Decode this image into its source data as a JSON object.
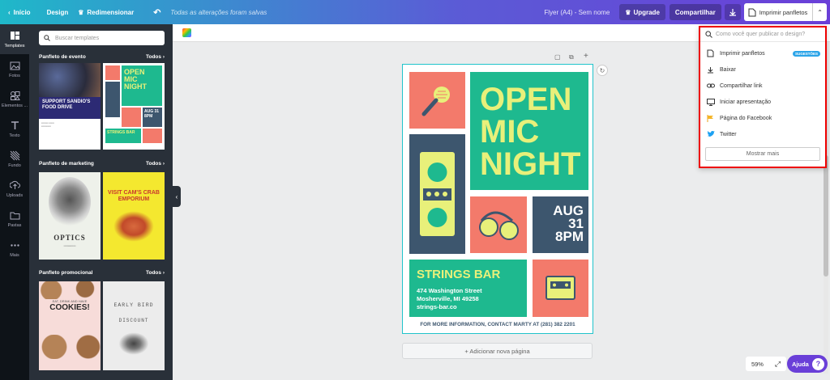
{
  "topbar": {
    "home": "Início",
    "design": "Design",
    "resize": "Redimensionar",
    "saved": "Todas as alterações foram salvas",
    "doc_name": "Flyer (A4) - Sem nome",
    "upgrade": "Upgrade",
    "share": "Compartilhar",
    "print": "Imprimir panfletos"
  },
  "rail": [
    {
      "label": "Templates",
      "icon": "templates-icon"
    },
    {
      "label": "Fotos",
      "icon": "photo-icon"
    },
    {
      "label": "Elementos ...",
      "icon": "shapes-icon"
    },
    {
      "label": "Texto",
      "icon": "text-icon"
    },
    {
      "label": "Fundo",
      "icon": "background-icon"
    },
    {
      "label": "Uploads",
      "icon": "upload-icon"
    },
    {
      "label": "Pastas",
      "icon": "folder-icon"
    },
    {
      "label": "Mais",
      "icon": "more-icon"
    }
  ],
  "panel": {
    "search_placeholder": "Buscar templates",
    "sections": [
      {
        "title": "Panfleto de evento",
        "all": "Todos"
      },
      {
        "title": "Panfleto de marketing",
        "all": "Todos"
      },
      {
        "title": "Panfleto promocional",
        "all": "Todos"
      }
    ],
    "thumbs": {
      "t1": {
        "title": "SUPPORT SANDIO'S FOOD DRIVE"
      },
      "t2": {
        "title": "OPEN MIC NIGHT",
        "sub": "STRINGS BAR",
        "date": "AUG 31 8PM"
      },
      "t3": {
        "title": "OPTICS"
      },
      "t4": {
        "title": "VISIT CAM'S CRAB EMPORIUM"
      },
      "t5": {
        "title": "COOKIES!",
        "top": "EAT, DRINK AND HAVE"
      },
      "t6": {
        "title": "EARLY BIRD",
        "sub": "DISCOUNT"
      }
    }
  },
  "flyer": {
    "title_lines": [
      "OPEN",
      "MIC",
      "NIGHT"
    ],
    "date_lines": [
      "AUG",
      "31",
      "8PM"
    ],
    "venue": "STRINGS BAR",
    "addr_lines": [
      "474 Washington Street",
      "Mosherville, MI 49258",
      "strings-bar.co"
    ],
    "footer": "FOR MORE INFORMATION, CONTACT MARTY AT (281) 382 2201"
  },
  "add_page": "+ Adicionar nova página",
  "dropdown": {
    "search_placeholder": "Como você quer publicar o design?",
    "items": [
      {
        "label": "Imprimir panfletos",
        "icon": "print-doc-icon",
        "badge": "SUGESTÕES"
      },
      {
        "label": "Baixar",
        "icon": "download-icon"
      },
      {
        "label": "Compartilhar link",
        "icon": "link-icon"
      },
      {
        "label": "Iniciar apresentação",
        "icon": "present-icon"
      },
      {
        "label": "Página do Facebook",
        "icon": "facebook-flag-icon"
      },
      {
        "label": "Twitter",
        "icon": "twitter-icon"
      }
    ],
    "more": "Mostrar mais"
  },
  "zoom": "59%",
  "help": "Ajuda",
  "help_q": "?",
  "colors": {
    "teal": "#1eb98f",
    "salmon": "#f37a6b",
    "navy": "#3d566e",
    "yellow": "#e8f07a",
    "accent": "#20c4cb"
  }
}
